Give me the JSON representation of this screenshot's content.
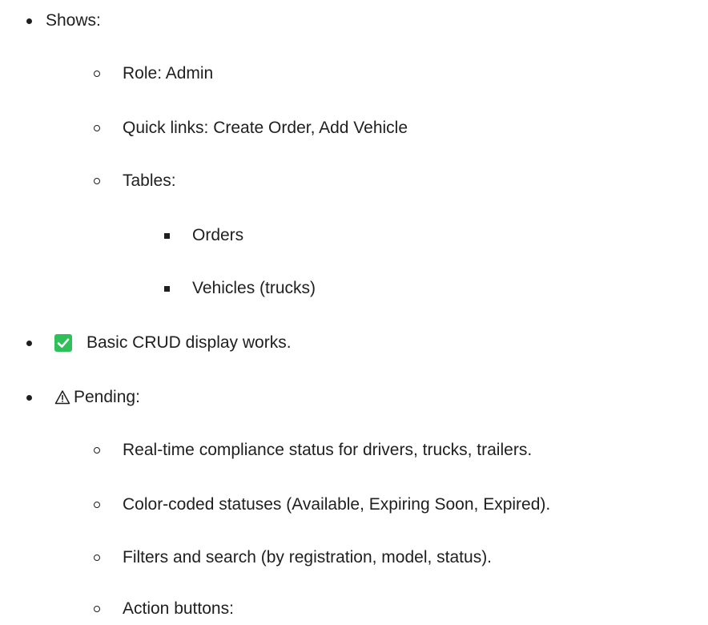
{
  "items": [
    {
      "level": 1,
      "text": "Shows:"
    },
    {
      "level": 2,
      "text": "Role: Admin"
    },
    {
      "level": 2,
      "text": "Quick links: Create Order, Add Vehicle"
    },
    {
      "level": 2,
      "text": "Tables:"
    },
    {
      "level": 3,
      "text": "Orders"
    },
    {
      "level": 3,
      "text": "Vehicles (trucks)"
    },
    {
      "level": 1,
      "icon": "check-box-icon",
      "text": "Basic CRUD display works."
    },
    {
      "level": 1,
      "icon": "warning-icon",
      "text": "Pending:"
    },
    {
      "level": 2,
      "text": "Real-time compliance status for drivers, trucks, trailers."
    },
    {
      "level": 2,
      "text": "Color-coded statuses (Available, Expiring Soon, Expired)."
    },
    {
      "level": 2,
      "text": "Filters and search (by registration, model, status)."
    },
    {
      "level": 2,
      "text": "Action buttons:"
    }
  ],
  "colors": {
    "text": "#1f1f1f",
    "check_green": "#2fc05a"
  }
}
